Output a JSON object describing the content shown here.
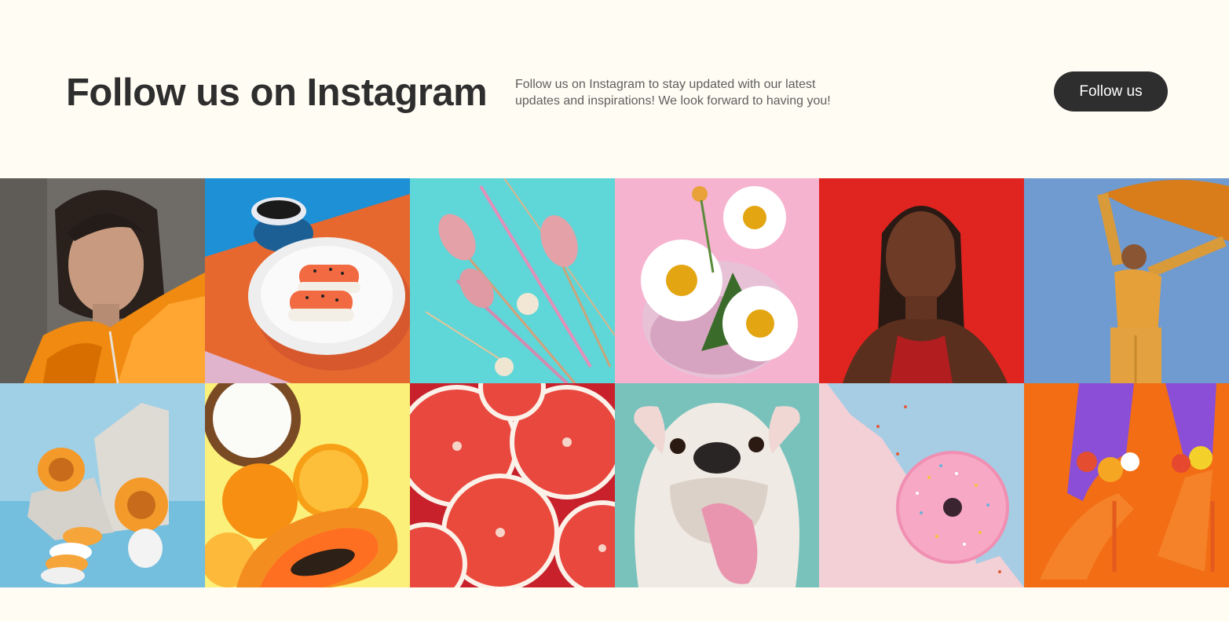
{
  "header": {
    "title": "Follow us on Instagram",
    "description": "Follow us on Instagram to stay updated with our latest updates and inspirations! We look forward to having you!",
    "button_label": "Follow us"
  },
  "colors": {
    "background": "#fffcf3",
    "text": "#2e2e2e",
    "muted_text": "#5e5e5e",
    "button_bg": "#2e2e2e",
    "button_text": "#ffffff"
  }
}
